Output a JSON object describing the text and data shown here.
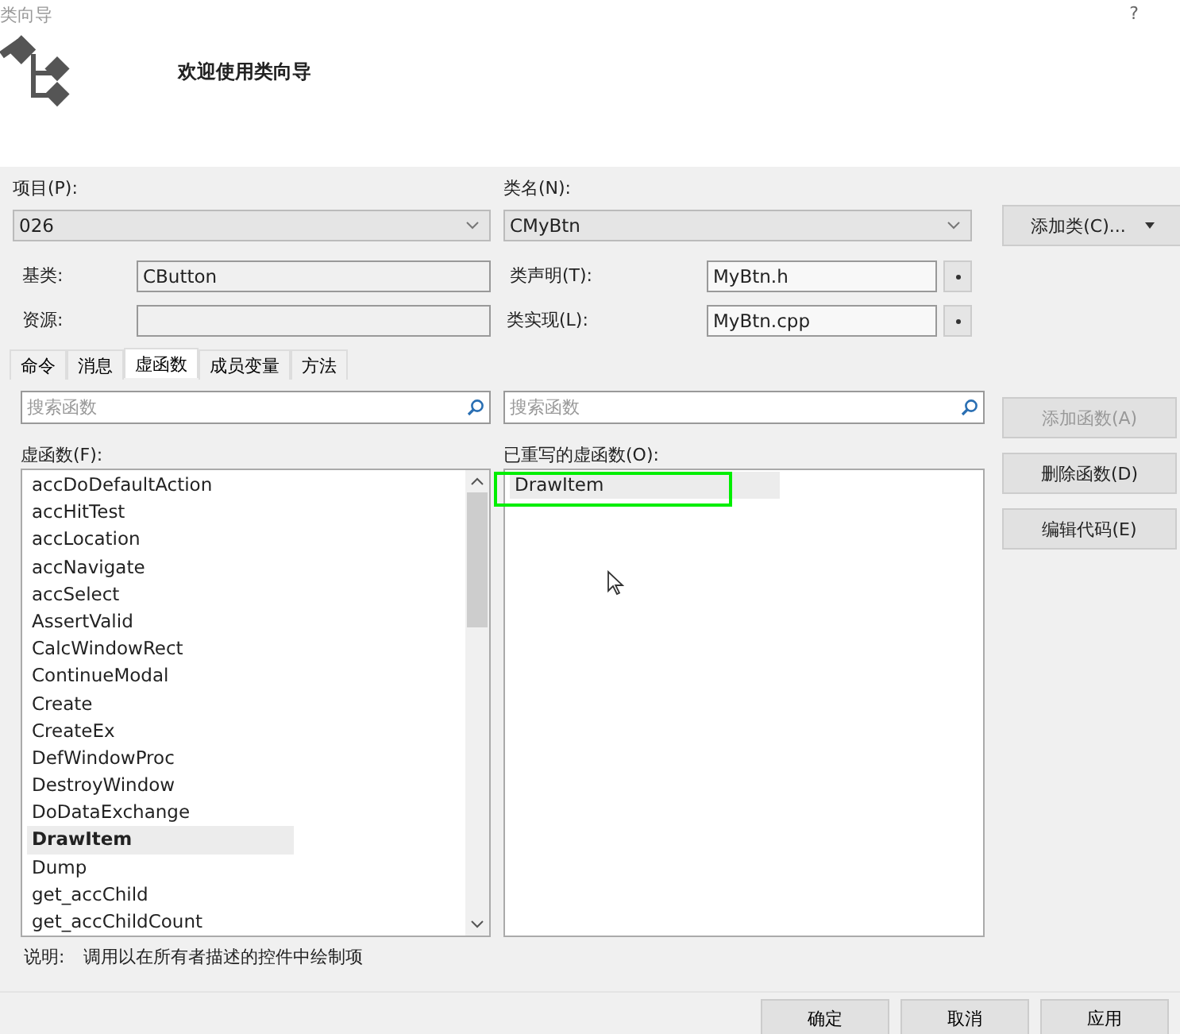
{
  "window": {
    "title": "类向导",
    "help": "?"
  },
  "header": {
    "title": "欢迎使用类向导"
  },
  "project": {
    "label": "项目(P):",
    "value": "026"
  },
  "class_name": {
    "label": "类名(N):",
    "value": "CMyBtn"
  },
  "add_class_button": {
    "label": "添加类(C)..."
  },
  "base_class": {
    "label": "基类:",
    "value": "CButton"
  },
  "class_declaration": {
    "label": "类声明(T):",
    "value": "MyBtn.h"
  },
  "resource": {
    "label": "资源:"
  },
  "class_implementation": {
    "label": "类实现(L):",
    "value": "MyBtn.cpp"
  },
  "tabs": [
    {
      "label": "命令",
      "selected": false
    },
    {
      "label": "消息",
      "selected": false
    },
    {
      "label": "虚函数",
      "selected": true
    },
    {
      "label": "成员变量",
      "selected": false
    },
    {
      "label": "方法",
      "selected": false
    }
  ],
  "virtual_functions": {
    "search": {
      "placeholder": "搜索函数"
    },
    "label": "虚函数(F):",
    "items": [
      {
        "name": "accDoDefaultAction",
        "selected": false,
        "overridden": false
      },
      {
        "name": "accHitTest",
        "selected": false,
        "overridden": false
      },
      {
        "name": "accLocation",
        "selected": false,
        "overridden": false
      },
      {
        "name": "accNavigate",
        "selected": false,
        "overridden": false
      },
      {
        "name": "accSelect",
        "selected": false,
        "overridden": false
      },
      {
        "name": "AssertValid",
        "selected": false,
        "overridden": false
      },
      {
        "name": "CalcWindowRect",
        "selected": false,
        "overridden": false
      },
      {
        "name": "ContinueModal",
        "selected": false,
        "overridden": false
      },
      {
        "name": "Create",
        "selected": false,
        "overridden": false
      },
      {
        "name": "CreateEx",
        "selected": false,
        "overridden": false
      },
      {
        "name": "DefWindowProc",
        "selected": false,
        "overridden": false
      },
      {
        "name": "DestroyWindow",
        "selected": false,
        "overridden": false
      },
      {
        "name": "DoDataExchange",
        "selected": false,
        "overridden": false
      },
      {
        "name": "DrawItem",
        "selected": true,
        "overridden": true
      },
      {
        "name": "Dump",
        "selected": false,
        "overridden": false
      },
      {
        "name": "get_accChild",
        "selected": false,
        "overridden": false
      },
      {
        "name": "get_accChildCount",
        "selected": false,
        "overridden": false
      }
    ]
  },
  "overridden_functions": {
    "search": {
      "placeholder": "搜索函数"
    },
    "label": "已重写的虚函数(O):",
    "items": [
      {
        "name": "DrawItem",
        "selected": true,
        "highlighted": true
      }
    ]
  },
  "function_buttons": [
    {
      "label": "添加函数(A)",
      "disabled": true
    },
    {
      "label": "删除函数(D)",
      "disabled": false
    },
    {
      "label": "编辑代码(E)",
      "disabled": false
    }
  ],
  "description": {
    "label": "说明:",
    "text": "调用以在所有者描述的控件中绘制项"
  },
  "dialog_buttons": [
    "确定",
    "取消",
    "应用"
  ]
}
